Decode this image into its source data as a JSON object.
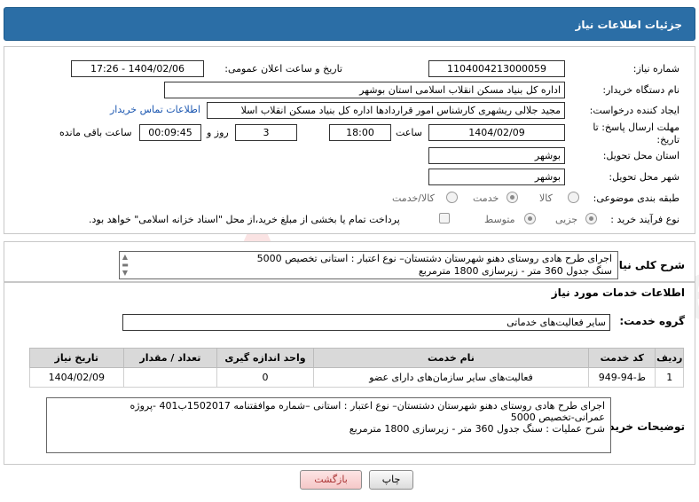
{
  "header": {
    "title": "جزئیات اطلاعات نیاز"
  },
  "fields": {
    "need_number_label": "شماره نیاز:",
    "need_number": "1104004213000059",
    "announce_label": "تاریخ و ساعت اعلان عمومی:",
    "announce_value": "1404/02/06 - 17:26",
    "buyer_org_label": "نام دستگاه خریدار:",
    "buyer_org": "اداره کل بنیاد مسکن انقلاب اسلامی استان بوشهر",
    "creator_label": "ایجاد کننده درخواست:",
    "creator": "مجید جلالی ریشهری کارشناس امور قراردادها اداره کل بنیاد مسکن انقلاب اسلا",
    "contact_link": "اطلاعات تماس خریدار",
    "deadline_label": "مهلت ارسال پاسخ: تا تاریخ:",
    "deadline_date": "1404/02/09",
    "time_label": "ساعت",
    "deadline_time": "18:00",
    "days_value": "3",
    "days_label": "روز و",
    "remaining_time": "00:09:45",
    "remaining_label": "ساعت باقی مانده",
    "province_label": "استان محل تحویل:",
    "province": "بوشهر",
    "city_label": "شهر محل تحویل:",
    "city": "بوشهر",
    "category_label": "طبقه بندی موضوعی:",
    "category_options": [
      "کالا",
      "خدمت",
      "کالا/خدمت"
    ],
    "category_selected": "خدمت",
    "process_label": "نوع فرآیند خرید :",
    "process_options": [
      "جزیی",
      "متوسط"
    ],
    "process_selected": "جزیی",
    "payment_note": "پرداخت تمام یا بخشی از مبلغ خرید،از محل \"اسناد خزانه اسلامی\" خواهد بود."
  },
  "summary": {
    "label": "شرح کلی نیاز:",
    "line1": "اجرای طرح هادی روستای دهنو  شهرستان دشتستان– نوع اعتبار : استانی تخصیص 5000",
    "line2": "سنگ جدول 360 متر - زیرسازی 1800 مترمربع"
  },
  "services": {
    "section_title": "اطلاعات خدمات مورد نیاز",
    "group_label": "گروه خدمت:",
    "group_value": "سایر فعالیت‌های خدماتی",
    "columns": [
      "ردیف",
      "کد خدمت",
      "نام خدمت",
      "واحد اندازه گیری",
      "تعداد / مقدار",
      "تاریخ نیاز"
    ],
    "rows": [
      [
        "1",
        "ط-94-949",
        "فعالیت‌های سایر سازمان‌های دارای عضو",
        "0",
        "",
        "1404/02/09"
      ]
    ]
  },
  "buyer_notes": {
    "label": "توضیحات خریدار:",
    "line1": "اجرای طرح هادی روستای دهنو  شهرستان دشتستان– نوع اعتبار : استانی –شماره موافقتنامه 1502017ب401 -پروژه",
    "line2": "عمرانی-تخصیص 5000",
    "line3": "شرح عملیات : سنگ جدول 360 متر - زیرسازی 1800 مترمربع"
  },
  "buttons": {
    "print": "چاپ",
    "back": "بازگشت"
  },
  "watermark": {
    "text": "AriaTender.neT"
  }
}
